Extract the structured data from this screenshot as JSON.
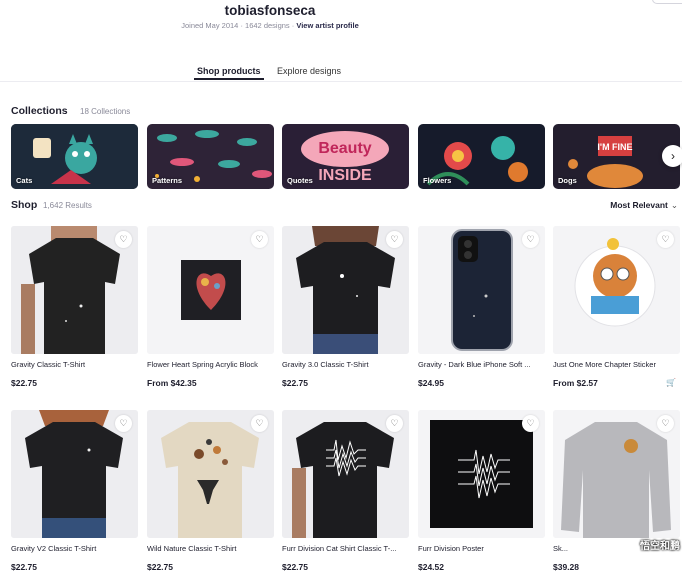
{
  "artist": {
    "name": "tobiasfonseca",
    "joined": "Joined May 2014",
    "designs": "1642 designs",
    "profile_link": "View artist profile"
  },
  "tabs": [
    {
      "label": "Shop products",
      "active": true
    },
    {
      "label": "Explore designs",
      "active": false
    }
  ],
  "collections": {
    "title": "Collections",
    "count": "18 Collections",
    "items": [
      {
        "label": "Cats"
      },
      {
        "label": "Patterns"
      },
      {
        "label": "Quotes"
      },
      {
        "label": "Flowers"
      },
      {
        "label": "Dogs"
      }
    ],
    "next_icon": "chevron-right-icon"
  },
  "shop": {
    "title": "Shop",
    "count": "1,642 Results",
    "sort_label": "Most Relevant",
    "sort_icon": "chevron-down-icon"
  },
  "products": [
    {
      "title": "Gravity Classic T-Shirt",
      "price": "$22.75"
    },
    {
      "title": "Flower Heart Spring Acrylic Block",
      "price": "From $42.35"
    },
    {
      "title": "Gravity 3.0 Classic T-Shirt",
      "price": "$22.75"
    },
    {
      "title": "Gravity - Dark Blue iPhone Soft ...",
      "price": "$24.95"
    },
    {
      "title": "Just One More Chapter Sticker",
      "price": "From $2.57"
    },
    {
      "title": "Gravity V2 Classic T-Shirt",
      "price": "$22.75"
    },
    {
      "title": "Wild Nature Classic T-Shirt",
      "price": "$22.75"
    },
    {
      "title": "Furr Division Cat Shirt Classic T-...",
      "price": "$22.75"
    },
    {
      "title": "Furr Division Poster",
      "price": "$24.52"
    },
    {
      "title": "Sk...",
      "price": "$39.28"
    }
  ],
  "icons": {
    "heart": "heart-icon",
    "cart": "cart-icon"
  },
  "watermark": "悟空和鹏"
}
